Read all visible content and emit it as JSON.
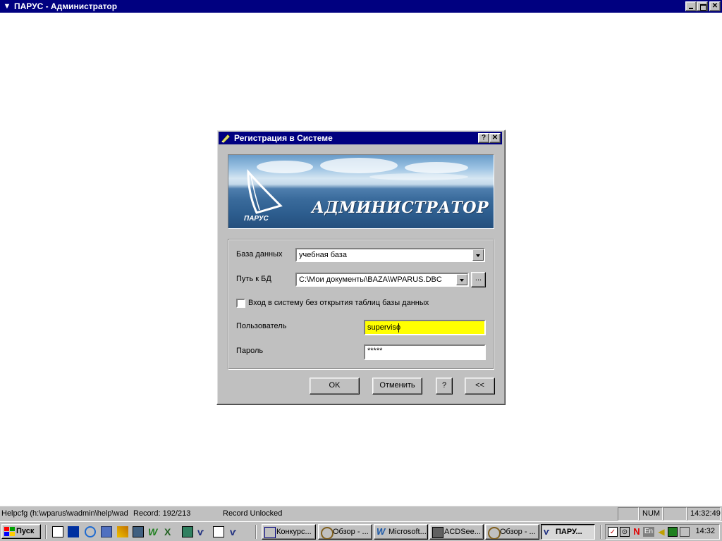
{
  "app": {
    "title": "ПАРУС - Администратор",
    "title_bg": "#000080"
  },
  "dialog": {
    "title": "Регистрация в Системе",
    "help_btn": "?",
    "close_btn": "✕",
    "banner": {
      "title": "АДМИНИСТРАТОР",
      "logo_text": "ПАРУС"
    },
    "database": {
      "label": "База данных",
      "value": "учебная база"
    },
    "db_path": {
      "label": "Путь к БД",
      "value": "C:\\Мои документы\\BAZA\\WPARUS.DBC",
      "browse": "..."
    },
    "no_tables_checkbox": {
      "label": "Вход в систему без открытия таблиц базы данных",
      "checked": false
    },
    "user": {
      "label": "Пользователь",
      "value": "superviso",
      "highlight": "#ffff00"
    },
    "password": {
      "label": "Пароль",
      "value": "*****"
    },
    "buttons": {
      "ok": "OK",
      "cancel": "Отменить",
      "help": "?",
      "collapse": "<<"
    }
  },
  "statusbar": {
    "helpcfg": "Helpcfg (h:\\wparus\\wadmin\\help\\wad",
    "record": "Record: 192/213",
    "lock": "Record Unlocked",
    "num": "NUM",
    "time": "14:32:49"
  },
  "taskbar": {
    "start": "Пуск",
    "tasks": [
      {
        "label": "Конкурс...",
        "icon": "window-icon"
      },
      {
        "label": "Обзор - ...",
        "icon": "magnifier-icon"
      },
      {
        "label": "Microsoft...",
        "icon": "word-icon"
      },
      {
        "label": "ACDSee...",
        "icon": "image-viewer-icon"
      },
      {
        "label": "Обзор - ...",
        "icon": "magnifier-icon"
      },
      {
        "label": "ПАРУ...",
        "icon": "parus-icon"
      }
    ],
    "tray_lang": "En",
    "tray_n": "N",
    "clock": "14:32"
  }
}
